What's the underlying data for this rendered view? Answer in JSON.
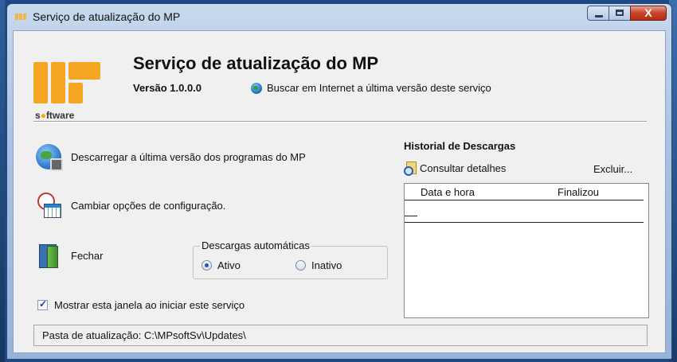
{
  "window": {
    "title": "Serviço de atualização do MP",
    "controls": {
      "minimize": "–",
      "maximize": "□",
      "close": "X"
    }
  },
  "header": {
    "logo_text_prefix": "s",
    "logo_text_suffix": "ftware",
    "app_title": "Serviço de atualização do MP",
    "version": "Versão 1.0.0.0",
    "search_link": "Buscar em Internet a última versão deste serviço"
  },
  "actions": {
    "download": "Descarregar a última versão dos programas do MP",
    "config": "Cambiar opções de configuração.",
    "close": "Fechar"
  },
  "auto_downloads": {
    "legend": "Descargas automáticas",
    "options": [
      {
        "label": "Ativo",
        "selected": true
      },
      {
        "label": "Inativo",
        "selected": false
      }
    ]
  },
  "startup_checkbox": {
    "label": "Mostrar esta janela ao iniciar este serviço",
    "checked": true
  },
  "history": {
    "title": "Historial de Descargas",
    "details_link": "Consultar detalhes",
    "delete_link": "Excluir...",
    "columns": [
      "Data e hora",
      "Finalizou"
    ],
    "rows": []
  },
  "status": {
    "text": "Pasta de atualização: C:\\MPsoftSv\\Updates\\"
  },
  "colors": {
    "logo_orange": "#f5a623",
    "title_bar": "#a9c2e3",
    "client_bg": "#f0f0f0"
  }
}
